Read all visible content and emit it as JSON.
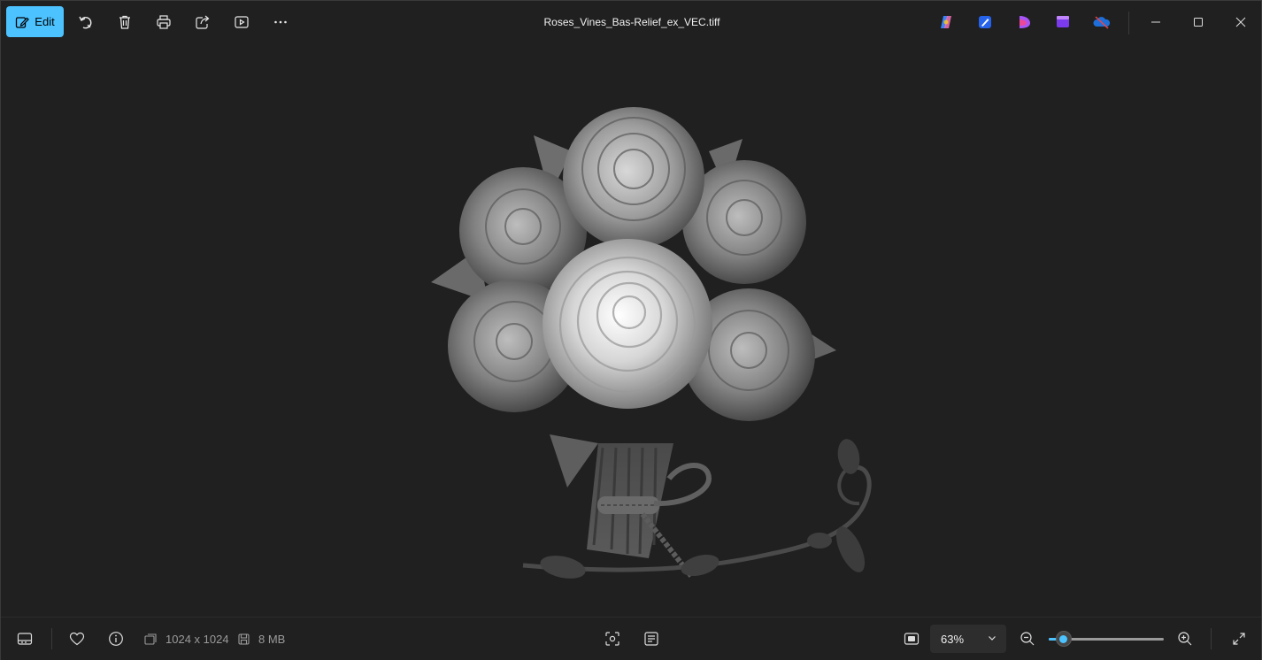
{
  "window": {
    "title": "Roses_Vines_Bas-Relief_ex_VEC.tiff"
  },
  "toolbar": {
    "edit_label": "Edit",
    "icons": [
      "edit-icon",
      "rotate-icon",
      "delete-icon",
      "print-icon",
      "share-icon",
      "slideshow-icon",
      "more-icon"
    ],
    "app_icons": [
      "copilot-icon",
      "designer-icon",
      "clipchamp-icon",
      "clipchamp-video-icon",
      "onedrive-icon"
    ]
  },
  "status": {
    "dimensions": "1024 x 1024",
    "file_size": "8 MB"
  },
  "zoom": {
    "value_label": "63%",
    "level": 0.13
  },
  "colors": {
    "accent": "#4cc2ff",
    "background": "#202020"
  }
}
